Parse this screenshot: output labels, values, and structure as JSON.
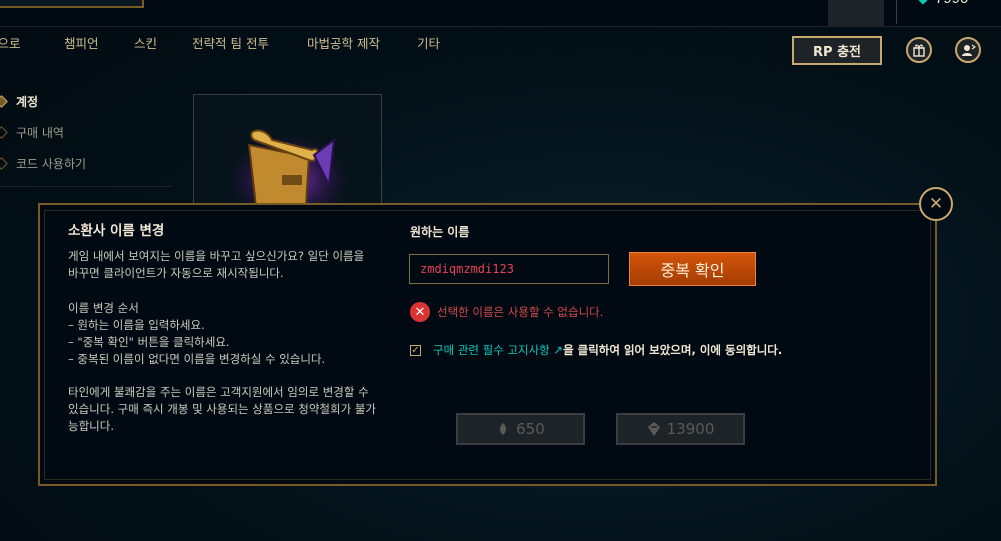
{
  "topbar": {
    "rp_balance_partial": "7990",
    "progress": 0.88
  },
  "nav": {
    "items": [
      "홈으로",
      "챔피언",
      "스킨",
      "전략적 팀 전투",
      "마법공학 제작",
      "기타"
    ],
    "rp_button": "RP 충전"
  },
  "sidebar": {
    "items": [
      {
        "label": "계정",
        "active": true
      },
      {
        "label": "구매 내역",
        "active": false
      },
      {
        "label": "코드 사용하기",
        "active": false
      }
    ]
  },
  "dialog": {
    "title": "소환사 이름 변경",
    "intro": "게임 내에서 보여지는 이름을 바꾸고 싶으신가요? 일단 이름을\n바꾸면 클라이언트가 자동으로 재시작됩니다.",
    "steps": "이름 변경 순서\n– 원하는 이름을 입력하세요.\n– \"중복 확인\" 버튼을 클릭하세요.\n– 중복된 이름이 없다면 이름을 변경하실 수 있습니다.",
    "warning": "타인에게 불쾌감을 주는 이름은 고객지원에서 임의로 변경할 수\n있습니다. 구매 즉시 개봉 및 사용되는 상품으로 청약철회가 불가\n능합니다.",
    "field_label": "원하는 이름",
    "name_value": "zmdiqmzmdi123",
    "check_button": "중복 확인",
    "error_text": "선택한 이름은 사용할 수 없습니다.",
    "agree_link": "구매 관련 필수 고지사항",
    "agree_rest": "을 클릭하여 읽어 보았으며, 이에 동의합니다.",
    "agree_checked": true,
    "price_rp": "650",
    "price_be": "13900"
  },
  "colors": {
    "gold": "#c8aa6e",
    "teal": "#0ac8b9",
    "error": "#e84057",
    "orange": "#d3550a"
  }
}
